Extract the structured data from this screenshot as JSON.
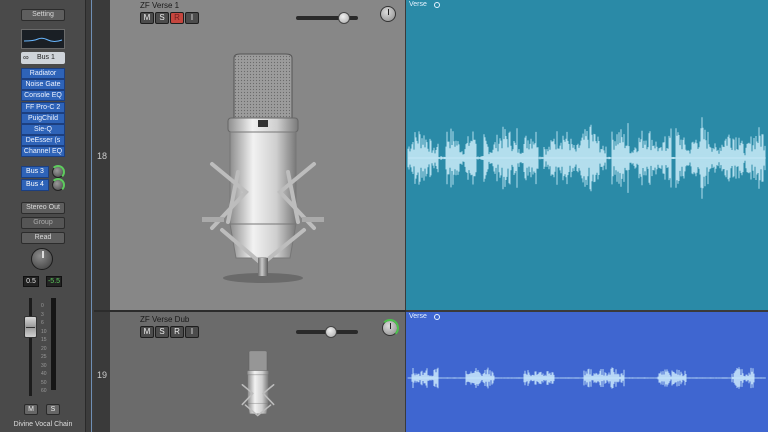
{
  "strip": {
    "setting_label": "Setting",
    "input_bus": "Bus 1",
    "plugins": [
      "Radiator",
      "Noise Gate",
      "Console EQ",
      "FF Pro-C 2",
      "PuigChild",
      "Sie-Q",
      "DeEsser (s",
      "Channel EQ"
    ],
    "sends": [
      {
        "label": "Bus 3"
      },
      {
        "label": "Bus 4"
      }
    ],
    "output": "Stereo Out",
    "group": "Group",
    "automation": "Read",
    "pan_value": "0.5",
    "peak_value": "-5.5",
    "fader_scale": [
      "0",
      "3",
      "6",
      "10",
      "15",
      "20",
      "25",
      "30",
      "40",
      "50",
      "60"
    ],
    "mute": "M",
    "solo": "S",
    "name": "Divine Vocal Chain"
  },
  "tracks": [
    {
      "number": "18",
      "name": "ZF Verse 1",
      "buttons": [
        "M",
        "S",
        "R",
        "I"
      ],
      "record_armed": true,
      "volume": 0.78,
      "region_name": "Verse"
    },
    {
      "number": "19",
      "name": "ZF Verse Dub",
      "buttons": [
        "M",
        "S",
        "R",
        "I"
      ],
      "record_armed": false,
      "volume": 0.56,
      "region_name": "Verse"
    }
  ],
  "colors": {
    "region_teal": "#2a8aa7",
    "region_blue": "#3f66d0",
    "plugin_blue": "#2e63b8",
    "record_red": "#c5463e",
    "peak_green": "#5ecb5e"
  },
  "icons": {
    "link": "link-icon",
    "loop": "loop-icon",
    "mic": "microphone-icon"
  }
}
